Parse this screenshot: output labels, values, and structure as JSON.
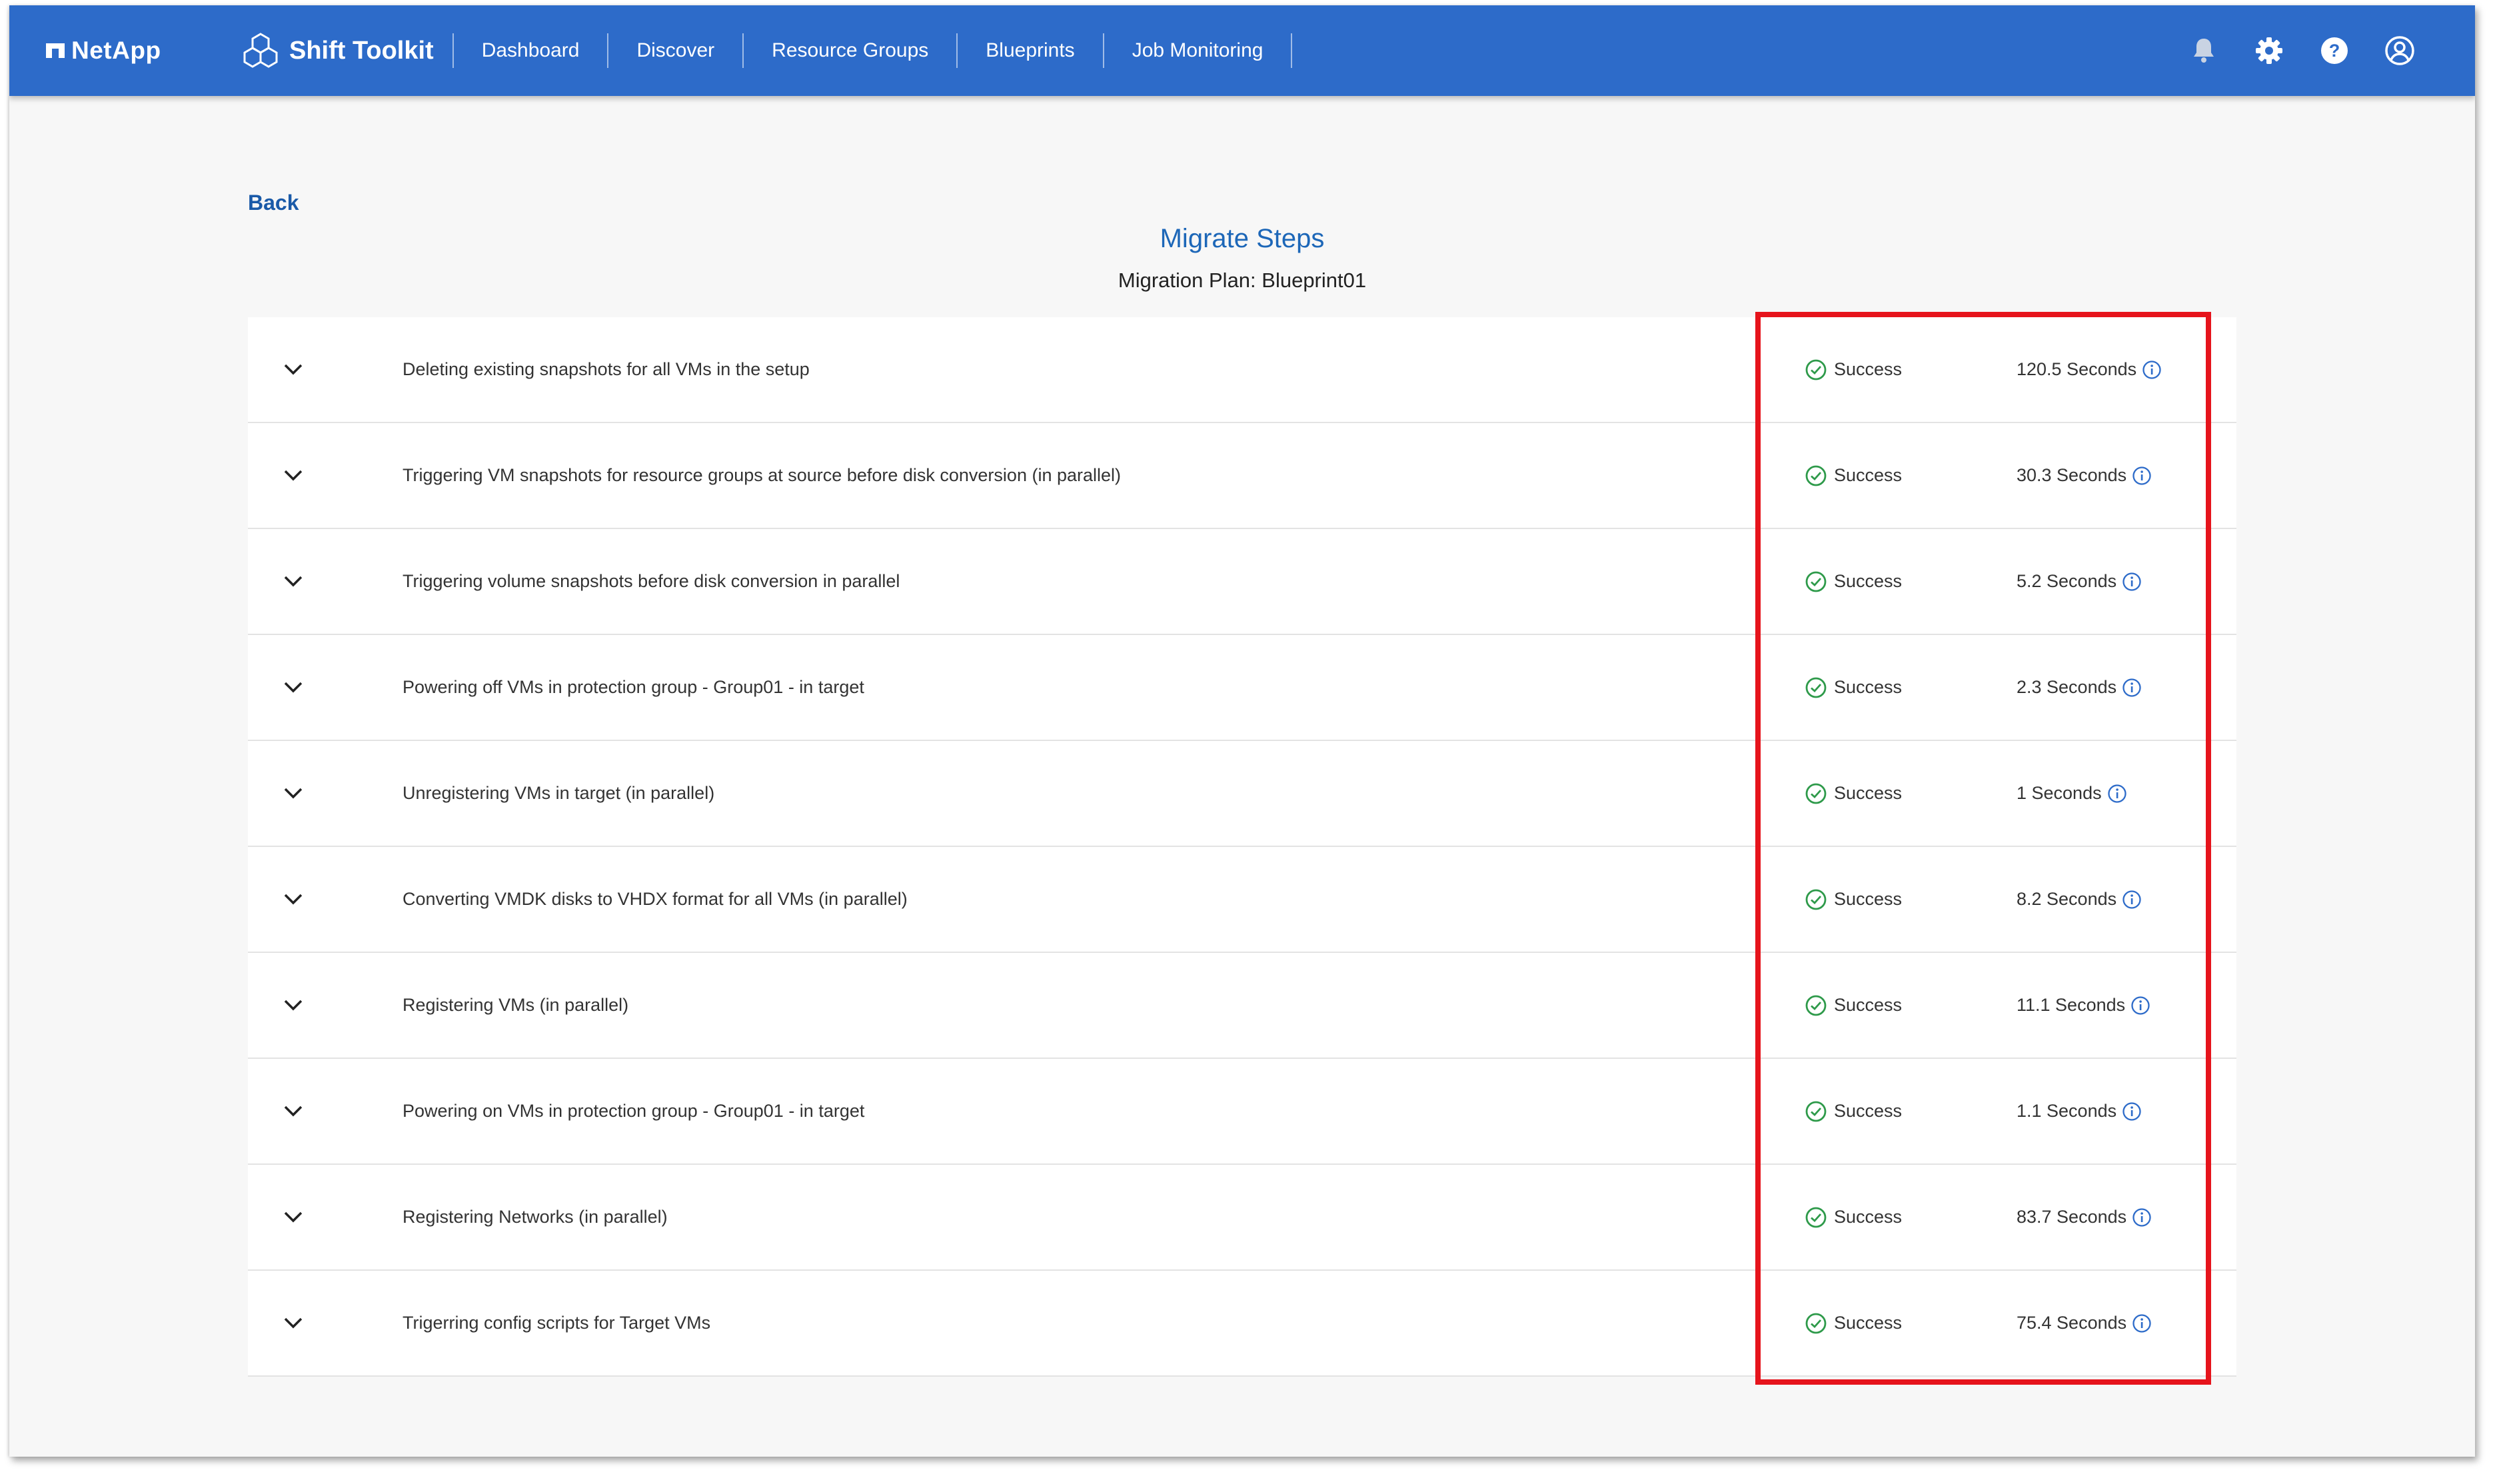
{
  "navbar": {
    "brand": "NetApp",
    "app_name": "Shift Toolkit",
    "items": [
      "Dashboard",
      "Discover",
      "Resource Groups",
      "Blueprints",
      "Job Monitoring"
    ],
    "icons": [
      "bell-icon",
      "gear-icon",
      "help-icon",
      "user-icon"
    ]
  },
  "page": {
    "back_label": "Back",
    "title": "Migrate Steps",
    "subtitle": "Migration Plan: Blueprint01"
  },
  "colors": {
    "navbar": "#2d6bc9",
    "title": "#1d67b8",
    "success": "#2e9a4a",
    "highlight": "#e6141c"
  },
  "steps": [
    {
      "label": "Deleting existing snapshots for all VMs in the setup",
      "status": "Success",
      "duration": "120.5 Seconds"
    },
    {
      "label": "Triggering VM snapshots for resource groups at source before disk conversion (in parallel)",
      "status": "Success",
      "duration": "30.3 Seconds"
    },
    {
      "label": "Triggering volume snapshots before disk conversion in parallel",
      "status": "Success",
      "duration": "5.2 Seconds"
    },
    {
      "label": "Powering off VMs in protection group - Group01 - in target",
      "status": "Success",
      "duration": "2.3 Seconds"
    },
    {
      "label": "Unregistering VMs in target (in parallel)",
      "status": "Success",
      "duration": "1 Seconds"
    },
    {
      "label": "Converting VMDK disks to VHDX format for all VMs (in parallel)",
      "status": "Success",
      "duration": "8.2 Seconds"
    },
    {
      "label": "Registering VMs (in parallel)",
      "status": "Success",
      "duration": "11.1 Seconds"
    },
    {
      "label": "Powering on VMs in protection group - Group01 - in target",
      "status": "Success",
      "duration": "1.1 Seconds"
    },
    {
      "label": "Registering Networks (in parallel)",
      "status": "Success",
      "duration": "83.7 Seconds"
    },
    {
      "label": "Trigerring config scripts for Target VMs",
      "status": "Success",
      "duration": "75.4 Seconds"
    }
  ]
}
